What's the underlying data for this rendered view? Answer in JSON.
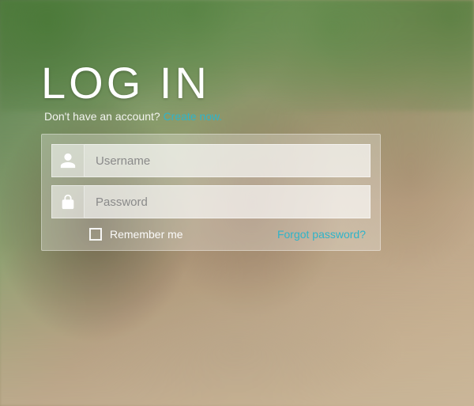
{
  "login": {
    "title": "LOG IN",
    "subtitle_text": "Don't have an account? ",
    "create_link": "Create now.",
    "username_placeholder": "Username",
    "password_placeholder": "Password",
    "remember_label": "Remember me",
    "forgot_label": "Forgot password?"
  },
  "colors": {
    "accent": "#2fb4c9",
    "text_light": "#ffffff"
  }
}
